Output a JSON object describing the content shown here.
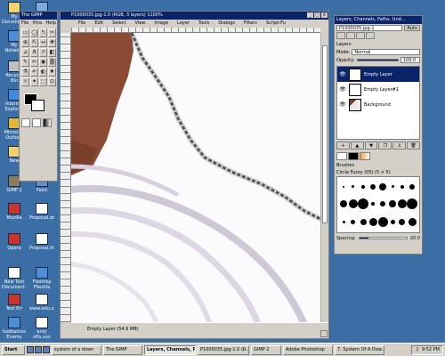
{
  "desktop": {
    "icons": [
      {
        "label": "My Documents",
        "icon": "folder-docs-icon",
        "color": "#f3d26b"
      },
      {
        "label": "Tele.Rt",
        "icon": "computer-icon",
        "color": "#7fa9de"
      },
      {
        "label": "My Network Places",
        "icon": "network-icon",
        "color": "#4c8ed9"
      },
      {
        "label": "Solitaire",
        "icon": "cards-icon",
        "color": "#2e7d32"
      },
      {
        "label": "Recycle Bin",
        "icon": "recycle-bin-icon",
        "color": "#c0c0c0"
      },
      {
        "label": "Sol Gui Pt",
        "icon": "app-icon",
        "color": "#3f6fb5"
      },
      {
        "label": "Internet Explorer",
        "icon": "ie-icon",
        "color": "#3c8be0"
      },
      {
        "label": "Adobe",
        "icon": "app-icon",
        "color": "#b22222"
      },
      {
        "label": "Microsoft Outlook",
        "icon": "outlook-icon",
        "color": "#e4b53b"
      },
      {
        "label": "Winamp",
        "icon": "winamp-icon",
        "color": "#e4b53b"
      },
      {
        "label": "New",
        "icon": "folder-icon",
        "color": "#f3d26b"
      },
      {
        "label": "Jasc",
        "icon": "app-icon",
        "color": "#a04040"
      },
      {
        "label": "GIMP 2",
        "icon": "gimp-icon",
        "color": "#8c7b61"
      },
      {
        "label": "Paint",
        "icon": "app-icon",
        "color": "#6a8ac8"
      },
      {
        "label": "Mozilla",
        "icon": "mozilla-icon",
        "color": "#c8342c"
      },
      {
        "label": "Proposal.doc",
        "icon": "word-doc-icon",
        "color": "#ffffff"
      },
      {
        "label": "Opera",
        "icon": "opera-icon",
        "color": "#c8342c"
      },
      {
        "label": "Proposal.rtx",
        "icon": "doc-icon",
        "color": "#ffffff"
      },
      {
        "label": "New Text Document.txt",
        "icon": "text-file-icon",
        "color": "#ffffff"
      },
      {
        "label": "Flashfxp Filezilla",
        "icon": "ftp-icon",
        "color": "#4c8ed9"
      },
      {
        "label": "Test Err",
        "icon": "app-icon",
        "color": "#c8342c"
      },
      {
        "label": "www.edu.xxx",
        "icon": "doc-icon",
        "color": "#ffffff"
      },
      {
        "label": "toolbarcos Enemy Te...",
        "icon": "app-icon",
        "color": "#4c8ed9"
      },
      {
        "label": "anty ofts.xxx",
        "icon": "doc-icon",
        "color": "#ffffff"
      },
      {
        "label": "Solutions",
        "icon": "app-icon",
        "color": "#3f6fb5"
      },
      {
        "label": "Software List.xxx",
        "icon": "doc-icon",
        "color": "#ffffff"
      }
    ]
  },
  "toolbox": {
    "title": "The GIMP",
    "menu": [
      "File",
      "Xtns",
      "Help"
    ],
    "tools": [
      "▭",
      "◯",
      "ϟ",
      "✂",
      "⊕",
      "⇱",
      "↔",
      "✥",
      "⊿",
      "A",
      "↗",
      "◧",
      "✎",
      "✏",
      "◉",
      "▒",
      "⚗",
      "✍",
      "◐",
      "♦",
      "☼",
      "✦",
      "⬚",
      "⊙"
    ],
    "fg_color": "#000000",
    "bg_color": "#ffffff"
  },
  "image_window": {
    "title": "P1000035.jpg-1.0 (RGB, 3 layers) 1100%",
    "menus": [
      "File",
      "Edit",
      "Select",
      "View",
      "Image",
      "Layer",
      "Tools",
      "Dialogs",
      "Filters",
      "Script-Fu"
    ],
    "status": "Empty Layer (54.9 MB)"
  },
  "layers_dock": {
    "title": "Layers, Channels, Paths, Und...",
    "image_select": "P1000035.jpg-1",
    "auto_label": "Auto",
    "section_label": "Layers",
    "mode_label": "Mode:",
    "mode_value": "Normal",
    "opacity_label": "Opacity:",
    "opacity_value": "100.0",
    "layers": [
      {
        "name": "Empty Layer",
        "active": true,
        "thumb": "blank"
      },
      {
        "name": "Empty Layer#1",
        "active": false,
        "thumb": "blank"
      },
      {
        "name": "Background",
        "active": false,
        "thumb": "photo"
      }
    ],
    "brushes_label": "Brushes",
    "brush_name": "Circle Fuzzy (05) (5 × 5)",
    "spacing_label": "Spacing:",
    "spacing_value": "20.0",
    "spacing_fraction": 0.2
  },
  "taskbar": {
    "start_label": "Start",
    "tasks": [
      {
        "label": "system of a down",
        "active": false
      },
      {
        "label": "The GIMP",
        "active": false
      },
      {
        "label": "Layers, Channels, Pa...",
        "active": true
      },
      {
        "label": "P1000035.jpg-1.0 (R...",
        "active": false
      },
      {
        "label": "GIMP 2",
        "active": false
      },
      {
        "label": "Adobe Photoshop",
        "active": false
      },
      {
        "label": "7. System Of A Dow...",
        "active": false
      }
    ],
    "clock": "9:52 PM"
  }
}
